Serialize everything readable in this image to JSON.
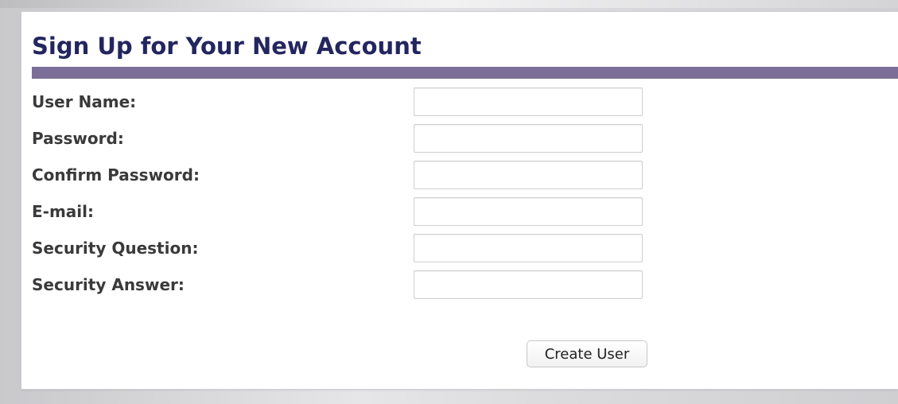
{
  "page": {
    "title": "Sign Up for Your New Account"
  },
  "form": {
    "fields": [
      {
        "label": "User Name:",
        "value": "",
        "type": "text"
      },
      {
        "label": "Password:",
        "value": "",
        "type": "password"
      },
      {
        "label": "Confirm Password:",
        "value": "",
        "type": "password"
      },
      {
        "label": "E-mail:",
        "value": "",
        "type": "text"
      },
      {
        "label": "Security Question:",
        "value": "",
        "type": "text"
      },
      {
        "label": "Security Answer:",
        "value": "",
        "type": "text"
      }
    ],
    "submit_label": "Create User"
  },
  "colors": {
    "title": "#23265e",
    "rule": "#7b6f99",
    "label": "#3a3a3a"
  }
}
